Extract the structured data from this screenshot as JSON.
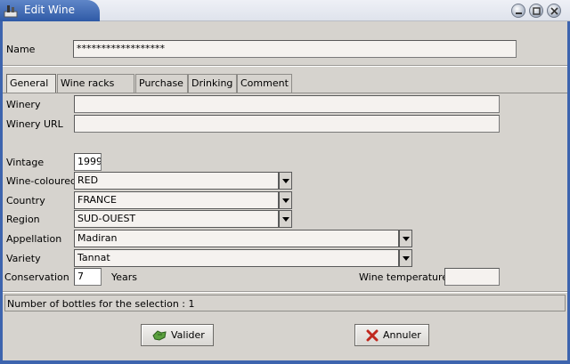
{
  "window": {
    "title": "Edit Wine"
  },
  "name": {
    "label": "Name",
    "value": "******************"
  },
  "tabs": [
    "General",
    "Wine racks",
    "Purchase",
    "Drinking",
    "Comment"
  ],
  "general": {
    "winery_label": "Winery",
    "winery_value": "",
    "winery_url_label": "Winery URL",
    "winery_url_value": "",
    "vintage_label": "Vintage",
    "vintage_value": "1999",
    "colour_label": "Wine-coloured",
    "colour_value": "RED",
    "country_label": "Country",
    "country_value": "FRANCE",
    "region_label": "Region",
    "region_value": "SUD-OUEST",
    "appellation_label": "Appellation",
    "appellation_value": "Madiran",
    "variety_label": "Variety",
    "variety_value": "Tannat",
    "conservation_label": "Conservation",
    "conservation_value": "7",
    "conservation_unit": "Years",
    "temperature_label": "Wine temperature",
    "temperature_value": ""
  },
  "status": {
    "text": "Number of bottles for the selection : 1"
  },
  "buttons": {
    "ok_label": "Valider",
    "cancel_label": "Annuler"
  },
  "colors": {
    "title_accent": "#2f5aa6",
    "frame": "#3d64ae",
    "ok_icon": "#3e8a2e",
    "cancel_icon": "#c0281e"
  }
}
